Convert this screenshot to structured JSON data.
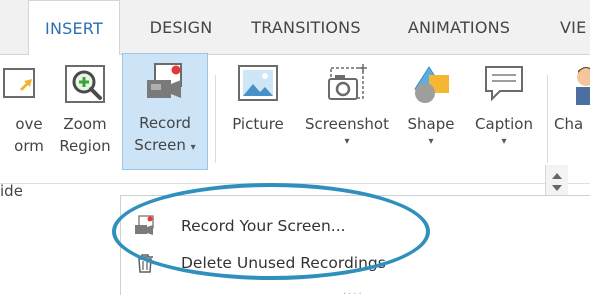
{
  "tabs": [
    {
      "label": "INSERT",
      "active": true
    },
    {
      "label": "DESIGN",
      "active": false
    },
    {
      "label": "TRANSITIONS",
      "active": false
    },
    {
      "label": "ANIMATIONS",
      "active": false
    },
    {
      "label": "VIE",
      "active": false
    }
  ],
  "ribbon": {
    "move_form": {
      "line1": "ove",
      "line2": "orm"
    },
    "zoom_region": {
      "line1": "Zoom",
      "line2": "Region"
    },
    "record_screen": {
      "line1": "Record",
      "line2": "Screen"
    },
    "picture": {
      "label": "Picture"
    },
    "screenshot": {
      "label": "Screenshot"
    },
    "shape": {
      "label": "Shape"
    },
    "caption": {
      "label": "Caption"
    },
    "character": {
      "label": "Cha"
    },
    "group_label": "ide"
  },
  "menu": {
    "items": [
      {
        "label": "Record Your Screen...",
        "icon": "record-screen-icon"
      },
      {
        "label": "Delete Unused Recordings",
        "icon": "trash-icon"
      }
    ],
    "grip": "...."
  },
  "colors": {
    "accent": "#2b6fb6",
    "highlight_oval": "#2f8fbd",
    "selected_bg": "#cde4f7"
  }
}
